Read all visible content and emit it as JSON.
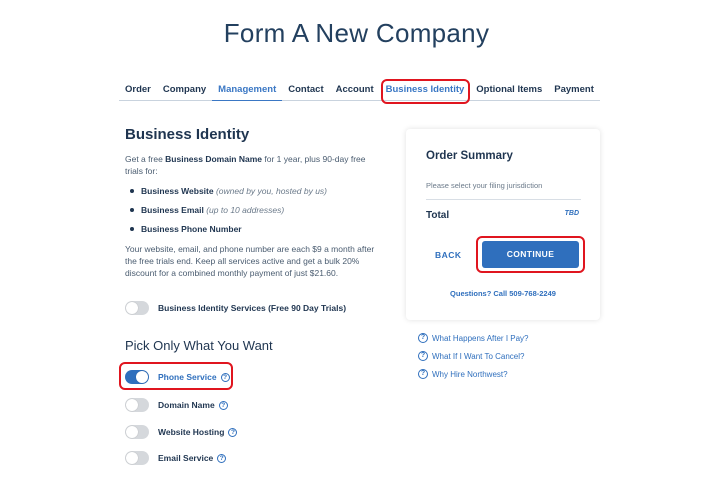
{
  "page": {
    "title": "Form A New Company"
  },
  "tabs": [
    {
      "label": "Order"
    },
    {
      "label": "Company"
    },
    {
      "label": "Management"
    },
    {
      "label": "Contact"
    },
    {
      "label": "Account"
    },
    {
      "label": "Business Identity"
    },
    {
      "label": "Optional Items"
    },
    {
      "label": "Payment"
    }
  ],
  "business_identity": {
    "title": "Business Identity",
    "intro_prefix": "Get a free ",
    "intro_bold": "Business Domain Name",
    "intro_suffix": " for 1 year, plus 90-day free trials for:",
    "bullets": [
      {
        "label": "Business Website",
        "note": "(owned by you, hosted by us)"
      },
      {
        "label": "Business Email",
        "note": "(up to 10 addresses)"
      },
      {
        "label": "Business Phone Number",
        "note": ""
      }
    ],
    "note": "Your website, email, and phone number are each $9 a month after the free trials end. Keep all services active and get a bulk 20% discount for a combined monthly payment of just $21.60.",
    "services_toggle": {
      "label": "Business Identity Services (Free 90 Day Trials)",
      "on": false
    }
  },
  "pick": {
    "title": "Pick Only What You Want",
    "options": [
      {
        "label": "Phone Service",
        "on": true
      },
      {
        "label": "Domain Name",
        "on": false
      },
      {
        "label": "Website Hosting",
        "on": false
      },
      {
        "label": "Email Service",
        "on": false
      }
    ]
  },
  "summary": {
    "title": "Order Summary",
    "hint": "Please select your filing jurisdiction",
    "total_label": "Total",
    "total_value": "TBD",
    "back_label": "BACK",
    "continue_label": "CONTINUE",
    "questions": "Questions? Call 509-768-2249"
  },
  "links": [
    {
      "label": "What Happens After I Pay?"
    },
    {
      "label": "What If I Want To Cancel?"
    },
    {
      "label": "Why Hire Northwest?"
    }
  ],
  "icons": {
    "help": "question-circle-icon"
  },
  "colors": {
    "accent": "#2f6fbd",
    "highlight": "#e0151f",
    "text": "#1f3550"
  }
}
